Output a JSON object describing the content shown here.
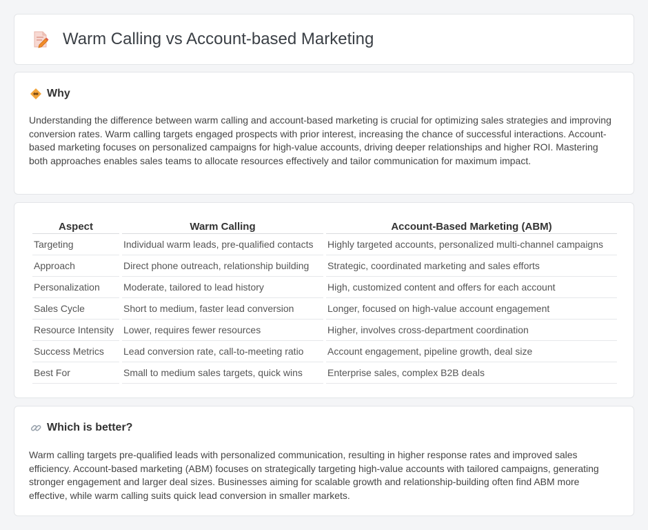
{
  "header": {
    "title": "Warm Calling vs Account-based Marketing",
    "icon": "document-pencil-icon"
  },
  "why": {
    "title": "Why",
    "icon": "handshake-icon",
    "body": "Understanding the difference between warm calling and account-based marketing is crucial for optimizing sales strategies and improving conversion rates. Warm calling targets engaged prospects with prior interest, increasing the chance of successful interactions. Account-based marketing focuses on personalized campaigns for high-value accounts, driving deeper relationships and higher ROI. Mastering both approaches enables sales teams to allocate resources effectively and tailor communication for maximum impact."
  },
  "comparison": {
    "headers": [
      "Aspect",
      "Warm Calling",
      "Account-Based Marketing (ABM)"
    ],
    "rows": [
      [
        "Targeting",
        "Individual warm leads, pre-qualified contacts",
        "Highly targeted accounts, personalized multi-channel campaigns"
      ],
      [
        "Approach",
        "Direct phone outreach, relationship building",
        "Strategic, coordinated marketing and sales efforts"
      ],
      [
        "Personalization",
        "Moderate, tailored to lead history",
        "High, customized content and offers for each account"
      ],
      [
        "Sales Cycle",
        "Short to medium, faster lead conversion",
        "Longer, focused on high-value account engagement"
      ],
      [
        "Resource Intensity",
        "Lower, requires fewer resources",
        "Higher, involves cross-department coordination"
      ],
      [
        "Success Metrics",
        "Lead conversion rate, call-to-meeting ratio",
        "Account engagement, pipeline growth, deal size"
      ],
      [
        "Best For",
        "Small to medium sales targets, quick wins",
        "Enterprise sales, complex B2B deals"
      ]
    ]
  },
  "better": {
    "title": "Which is better?",
    "icon": "link-icon",
    "body": "Warm calling targets pre-qualified leads with personalized communication, resulting in higher response rates and improved sales efficiency. Account-based marketing (ABM) focuses on strategically targeting high-value accounts with tailored campaigns, generating stronger engagement and larger deal sizes. Businesses aiming for scalable growth and relationship-building often find ABM more effective, while warm calling suits quick lead conversion in smaller markets."
  },
  "colors": {
    "background": "#f4f5f7",
    "card": "#ffffff",
    "accent_icon": "#f2a33a"
  }
}
